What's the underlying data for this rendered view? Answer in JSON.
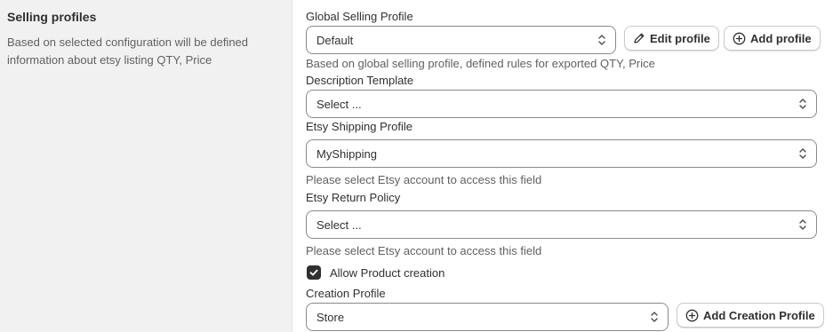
{
  "section": {
    "title": "Selling profiles",
    "description": "Based on selected configuration will be defined information about etsy listing QTY, Price"
  },
  "global_profile": {
    "label": "Global Selling Profile",
    "value": "Default",
    "edit_label": "Edit profile",
    "add_label": "Add profile",
    "help": "Based on global selling profile, defined rules for exported QTY, Price"
  },
  "description_template": {
    "label": "Description Template",
    "value": "Select ..."
  },
  "shipping_profile": {
    "label": "Etsy Shipping Profile",
    "value": "MyShipping",
    "help": "Please select Etsy account to access this field"
  },
  "return_policy": {
    "label": "Etsy Return Policy",
    "value": "Select ...",
    "help": "Please select Etsy account to access this field"
  },
  "allow_creation": {
    "label": "Allow Product creation",
    "checked": true
  },
  "creation_profile": {
    "label": "Creation Profile",
    "value": "Store",
    "add_label": "Add Creation Profile"
  }
}
